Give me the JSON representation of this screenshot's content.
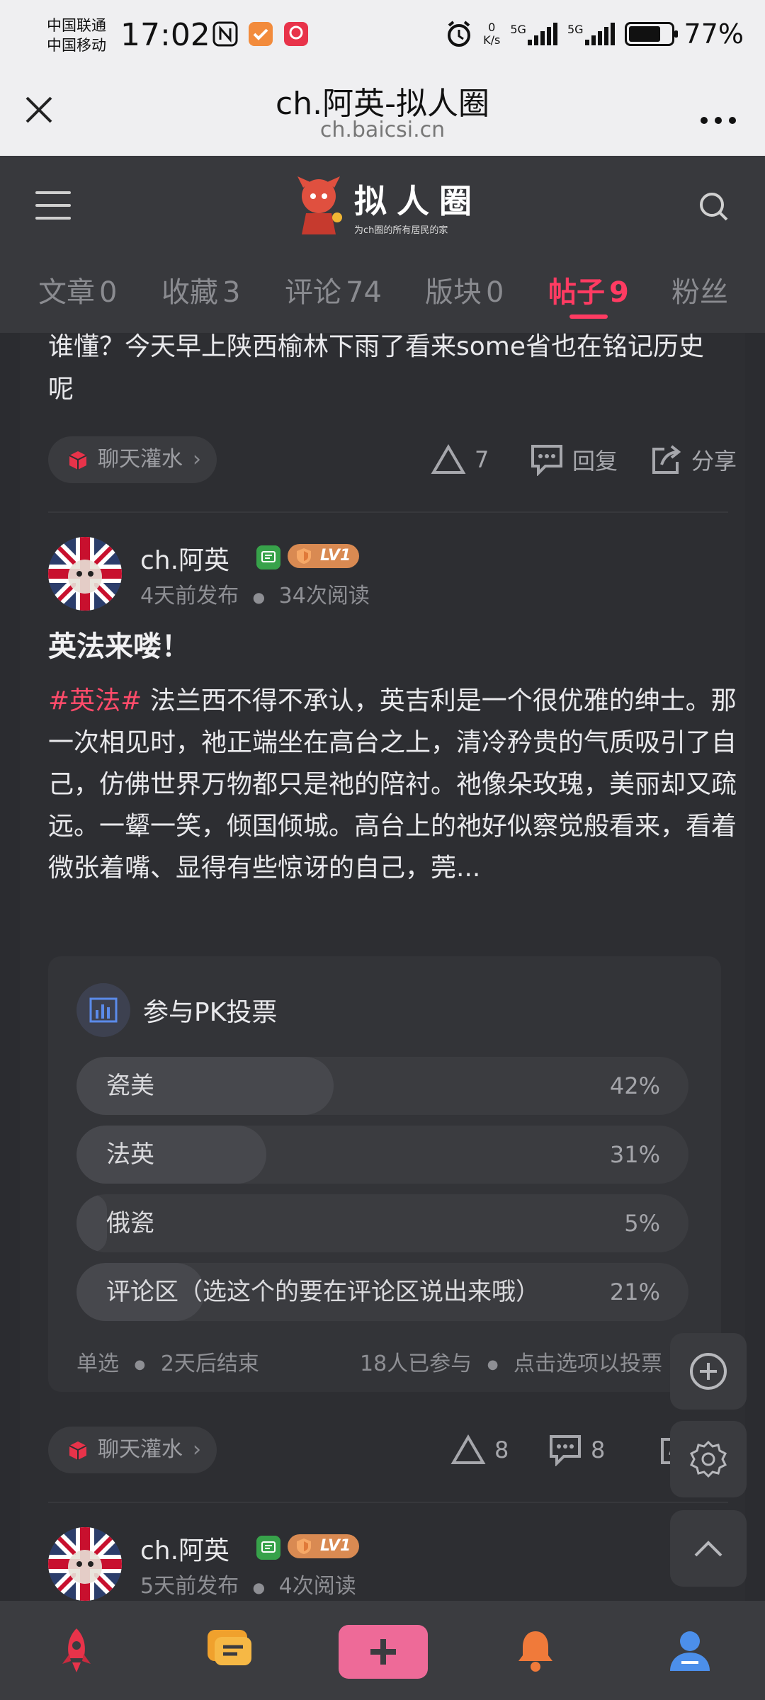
{
  "status_bar": {
    "carrier1": "中国联通",
    "carrier2": "中国移动",
    "time": "17:02",
    "net_speed_value": "0",
    "net_speed_unit": "K/s",
    "signal1": "5G",
    "signal2": "5G",
    "battery_percent": "77%",
    "battery_level": 0.77
  },
  "browser": {
    "title": "ch.阿英-拟人圈",
    "url": "ch.baicsi.cn",
    "more_label": "..."
  },
  "header": {
    "logo_title": "拟人圈",
    "logo_subtitle": "为ch圈的所有居民的家"
  },
  "tabs": [
    {
      "label": "文章",
      "count": "0"
    },
    {
      "label": "收藏",
      "count": "3"
    },
    {
      "label": "评论",
      "count": "74"
    },
    {
      "label": "版块",
      "count": "0"
    },
    {
      "label": "帖子",
      "count": "9",
      "active": true
    },
    {
      "label": "粉丝",
      "count": ""
    }
  ],
  "feed": {
    "prev_post": {
      "tail_text": "谁懂？今天早上陕西榆林下雨了看来some省也在铭记历史呢",
      "category": "聊天灌水",
      "likes": "7",
      "reply_label": "回复",
      "share_label": "分享"
    },
    "post": {
      "author": "ch.阿英",
      "level": "LV1",
      "time": "4天前发布",
      "views": "34次阅读",
      "title": "英法来喽！",
      "tag": "#英法#",
      "body": "法兰西不得不承认，英吉利是一个很优雅的绅士。那一次相见时，祂正端坐在高台之上，清冷矜贵的气质吸引了自己，仿佛世界万物都只是祂的陪衬。祂像朵玫瑰，美丽却又疏远。一颦一笑，倾国倾城。高台上的祂好似察觉般看来，看着微张着嘴、显得有些惊讶的自己，莞...",
      "poll": {
        "title": "参与PK投票",
        "options": [
          {
            "label": "瓷美",
            "percent": "42%",
            "value": 0.42
          },
          {
            "label": "法英",
            "percent": "31%",
            "value": 0.31
          },
          {
            "label": "俄瓷",
            "percent": "5%",
            "value": 0.05
          },
          {
            "label": "评论区（选这个的要在评论区说出来哦）",
            "percent": "21%",
            "value": 0.21
          }
        ],
        "mode": "单选",
        "ends": "2天后结束",
        "participants": "18人已参与",
        "hint": "点击选项以投票"
      },
      "category": "聊天灌水",
      "likes": "8",
      "comments": "8"
    },
    "next_post": {
      "author": "ch.阿英",
      "level": "LV1",
      "time": "5天前发布",
      "views": "4次阅读"
    }
  },
  "colors": {
    "accent": "#ff3b62",
    "background": "#2b2c30",
    "card": "#2d2e32",
    "compose": "#ee6a98"
  }
}
